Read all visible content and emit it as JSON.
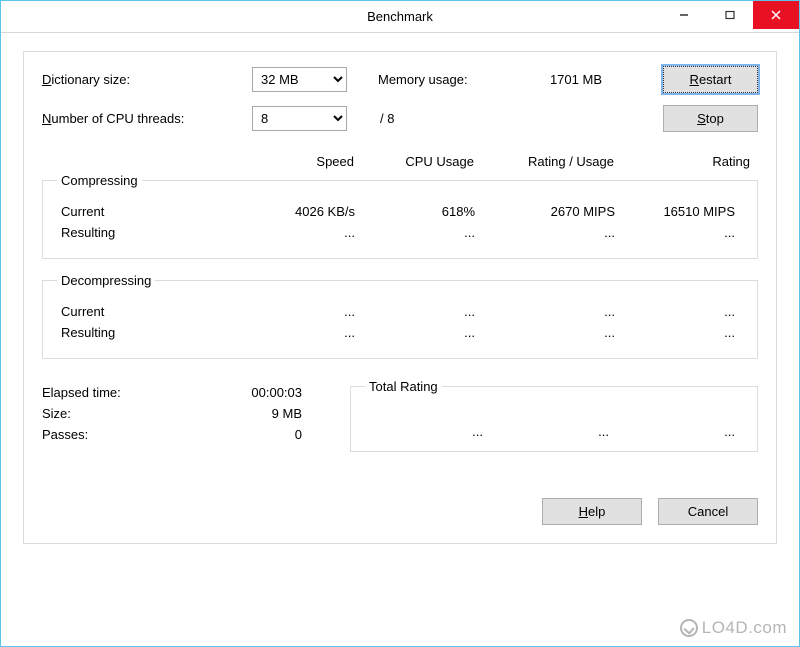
{
  "window": {
    "title": "Benchmark"
  },
  "controls": {
    "dictionary_label": "Dictionary size:",
    "dictionary_value": "32 MB",
    "threads_label": "Number of CPU threads:",
    "threads_value": "8",
    "threads_max": "/ 8",
    "memory_label": "Memory usage:",
    "memory_value": "1701 MB",
    "restart_label": "Restart",
    "stop_label": "Stop"
  },
  "headers": {
    "speed": "Speed",
    "cpu_usage": "CPU Usage",
    "rating_usage": "Rating / Usage",
    "rating": "Rating"
  },
  "compressing": {
    "legend": "Compressing",
    "rows": [
      {
        "label": "Current",
        "speed": "4026 KB/s",
        "cpu": "618%",
        "rating_usage": "2670 MIPS",
        "rating": "16510 MIPS"
      },
      {
        "label": "Resulting",
        "speed": "...",
        "cpu": "...",
        "rating_usage": "...",
        "rating": "..."
      }
    ]
  },
  "decompressing": {
    "legend": "Decompressing",
    "rows": [
      {
        "label": "Current",
        "speed": "...",
        "cpu": "...",
        "rating_usage": "...",
        "rating": "..."
      },
      {
        "label": "Resulting",
        "speed": "...",
        "cpu": "...",
        "rating_usage": "...",
        "rating": "..."
      }
    ]
  },
  "stats": {
    "elapsed_label": "Elapsed time:",
    "elapsed_value": "00:00:03",
    "size_label": "Size:",
    "size_value": "9 MB",
    "passes_label": "Passes:",
    "passes_value": "0"
  },
  "total": {
    "legend": "Total Rating",
    "values": [
      "...",
      "...",
      "..."
    ]
  },
  "buttons": {
    "help": "Help",
    "cancel": "Cancel"
  },
  "watermark": "LO4D.com"
}
